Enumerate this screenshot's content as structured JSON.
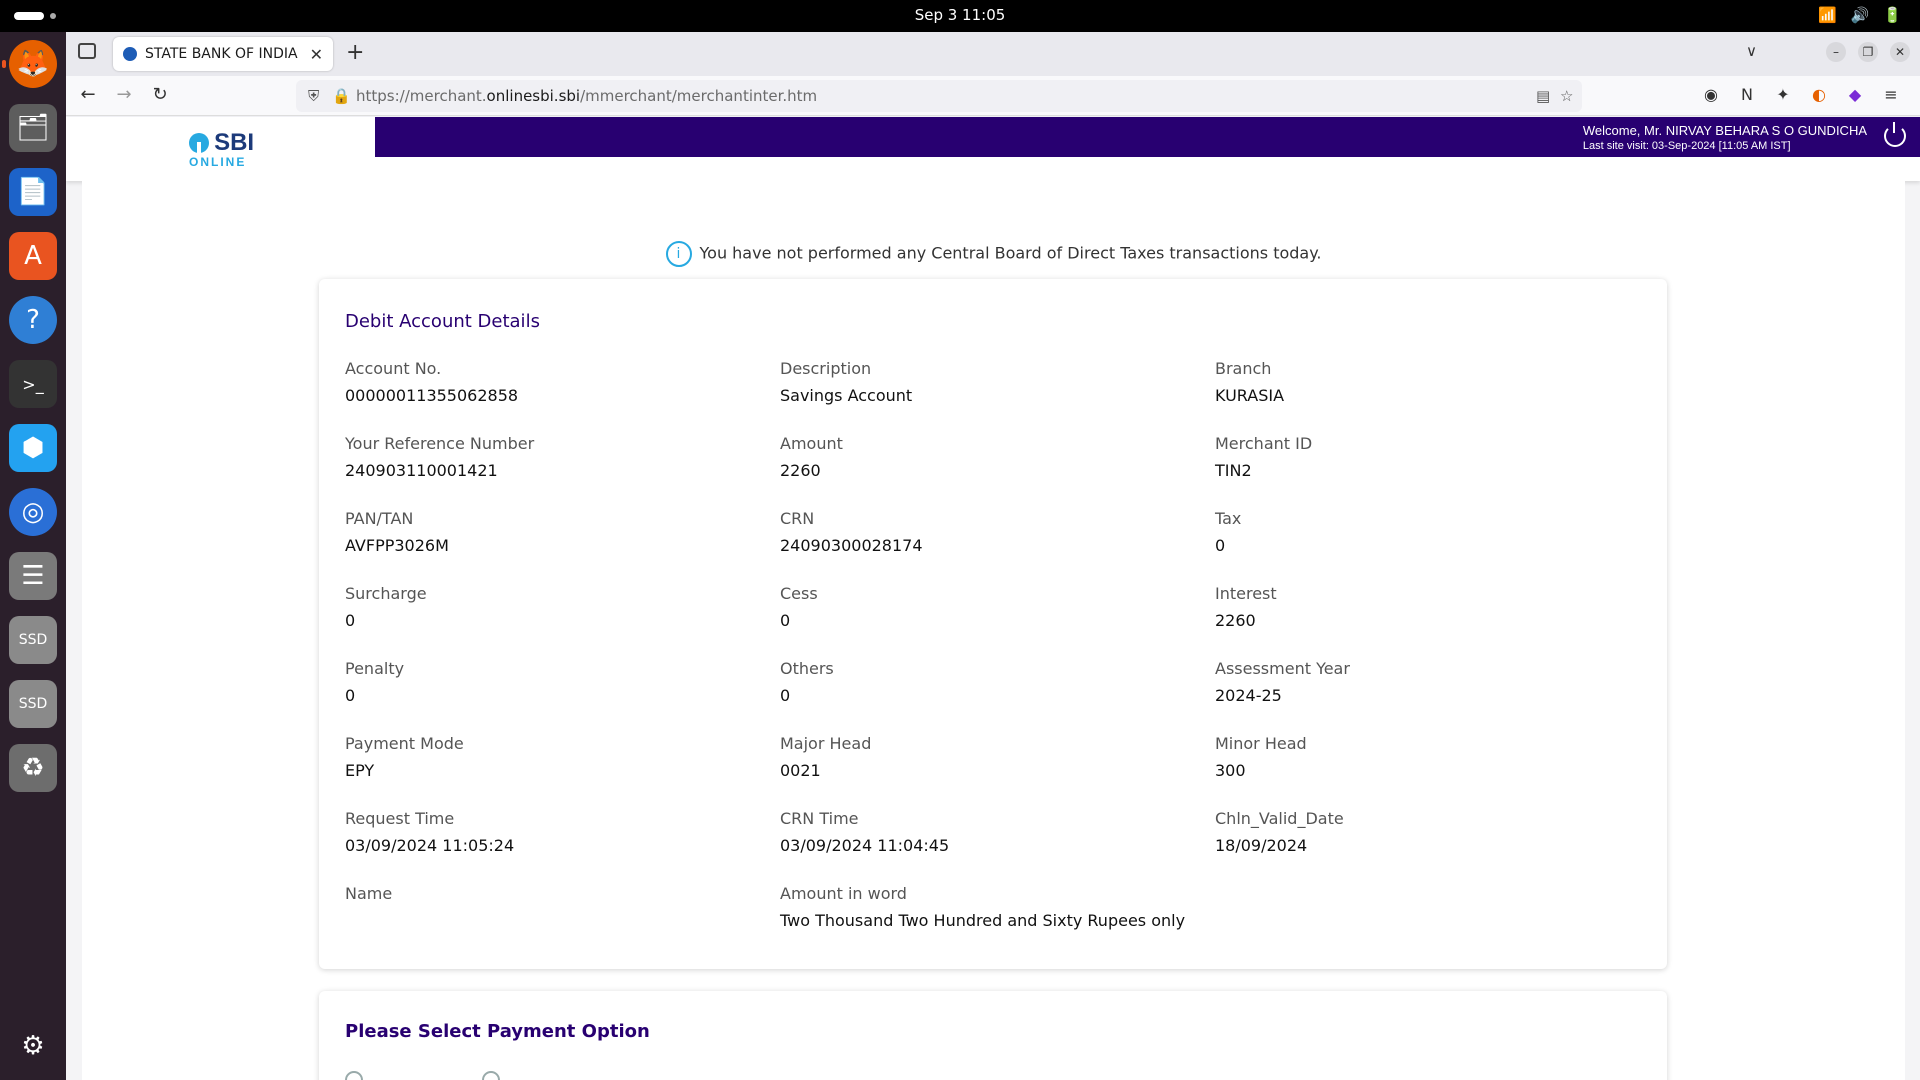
{
  "system": {
    "clock": "Sep 3  11:05"
  },
  "browser": {
    "tab_title": "STATE BANK OF INDIA",
    "url_prefix": "https://merchant.",
    "url_host": "onlinesbi.sbi",
    "url_path": "/mmerchant/merchantinter.htm"
  },
  "header": {
    "logo_text": "SBI",
    "logo_subtext": "ONLINE",
    "welcome": "Welcome, Mr. NIRVAY BEHARA S O GUNDICHA",
    "last_visit": "Last site visit: 03-Sep-2024 [11:05 AM IST]"
  },
  "notice": "You have not performed any Central Board of Direct Taxes transactions today.",
  "debit_card": {
    "title": "Debit Account Details",
    "fields": [
      {
        "label": "Account No.",
        "value": "00000011355062858"
      },
      {
        "label": "Description",
        "value": "Savings Account"
      },
      {
        "label": "Branch",
        "value": "KURASIA"
      },
      {
        "label": "Your Reference Number",
        "value": "240903110001421"
      },
      {
        "label": "Amount",
        "value": "2260"
      },
      {
        "label": "Merchant ID",
        "value": "TIN2"
      },
      {
        "label": "PAN/TAN",
        "value": "AVFPP3026M"
      },
      {
        "label": "CRN",
        "value": "24090300028174"
      },
      {
        "label": "Tax",
        "value": "0"
      },
      {
        "label": "Surcharge",
        "value": "0"
      },
      {
        "label": "Cess",
        "value": "0"
      },
      {
        "label": "Interest",
        "value": "2260"
      },
      {
        "label": "Penalty",
        "value": "0"
      },
      {
        "label": "Others",
        "value": "0"
      },
      {
        "label": "Assessment Year",
        "value": "2024-25"
      },
      {
        "label": "Payment Mode",
        "value": "EPY"
      },
      {
        "label": "Major Head",
        "value": "0021"
      },
      {
        "label": "Minor Head",
        "value": "300"
      },
      {
        "label": "Request Time",
        "value": "03/09/2024 11:05:24"
      },
      {
        "label": "CRN Time",
        "value": "03/09/2024 11:04:45"
      },
      {
        "label": "Chln_Valid_Date",
        "value": "18/09/2024"
      },
      {
        "label": "Name",
        "value": ""
      },
      {
        "label": "Amount in word",
        "value": "Two Thousand Two Hundred and Sixty Rupees only"
      }
    ]
  },
  "payment_card": {
    "title": "Please Select Payment Option"
  }
}
